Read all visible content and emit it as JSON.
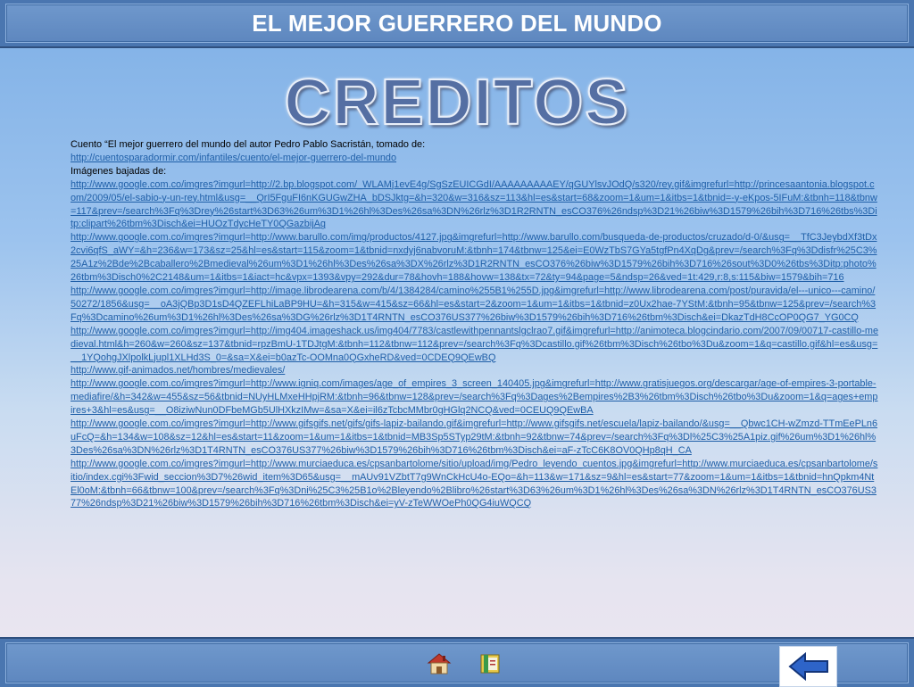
{
  "header": {
    "title": "EL MEJOR GUERRERO DEL MUNDO"
  },
  "slide": {
    "title": "CREDITOS",
    "intro": "Cuento “El mejor guerrero del mundo del autor Pedro Pablo Sacristán, tomado de:",
    "source_link": "http://cuentosparadormir.com/infantiles/cuento/el-mejor-guerrero-del-mundo",
    "images_label": "Imágenes bajadas de:",
    "image_links": [
      "http://www.google.com.co/imgres?imgurl=http://2.bp.blogspot.com/_WLAMj1evE4g/SgSzEUICGdI/AAAAAAAAAEY/qGUYlsvJOdQ/s320/rey.gif&imgrefurl=http://princesaantonia.blogspot.com/2009/05/el-sabio-y-un-rey.html&usg=__QrI5FguFI6nKGUGwZHA_bDSJktg=&h=320&w=316&sz=113&hl=es&start=68&zoom=1&um=1&itbs=1&tbnid=-y-eKpos-5IFuM:&tbnh=118&tbnw=117&prev=/search%3Fq%3Drey%26start%3D63%26um%3D1%26hl%3Des%26sa%3DN%26rlz%3D1R2RNTN_esCO376%26ndsp%3D21%26biw%3D1579%26bih%3D716%26tbs%3Ditp:clipart%26tbm%3Disch&ei=HUOzTdycHeTY0QGazbijAg",
      "http://www.google.com.co/imgres?imgurl=http://www.barullo.com/img/productos/4127.jpg&imgrefurl=http://www.barullo.com/busqueda-de-productos/cruzado/d-0/&usg=__TfC3JeybdXf3tDx2cvi6qfS_aWY=&h=236&w=173&sz=25&hl=es&start=115&zoom=1&tbnid=nxdyj6nabvoruM:&tbnh=174&tbnw=125&ei=E0WzTbS7GYa5tgfPn4XqDg&prev=/search%3Fq%3Ddisfr%25C3%25A1z%2Bde%2Bcaballero%2Bmedieval%26um%3D1%26hl%3Des%26sa%3DX%26rlz%3D1R2RNTN_esCO376%26biw%3D1579%26bih%3D716%26sout%3D0%26tbs%3Ditp:photo%26tbm%3Disch0%2C2148&um=1&itbs=1&iact=hc&vpx=1393&vpy=292&dur=78&hovh=188&hovw=138&tx=72&ty=94&page=5&ndsp=26&ved=1t:429,r:8,s:115&biw=1579&bih=716",
      "http://www.google.com.co/imgres?imgurl=http://image.librodearena.com/b/4/1384284/camino%255B1%255D.jpg&imgrefurl=http://www.librodearena.com/post/puravida/el---unico---camino/50272/1856&usg=__oA3jQBp3D1sD4QZEFLhiLaBP9HU=&h=315&w=415&sz=66&hl=es&start=2&zoom=1&um=1&itbs=1&tbnid=z0Ux2hae-7YStM:&tbnh=95&tbnw=125&prev=/search%3Fq%3Dcamino%26um%3D1%26hl%3Des%26sa%3DG%26rlz%3D1T4RNTN_esCO376US377%26biw%3D1579%26bih%3D716%26tbm%3Disch&ei=DkazTdH8CcOP0QG7_YG0CQ",
      "http://www.google.com.co/imgres?imgurl=http://img404.imageshack.us/img404/7783/castlewithpennantslgclrao7.gif&imgrefurl=http://animoteca.blogcindario.com/2007/09/00717-castillo-medieval.html&h=260&w=260&sz=137&tbnid=rpzBmU-1TDJtgM:&tbnh=112&tbnw=112&prev=/search%3Fq%3Dcastillo.gif%26tbm%3Disch%26tbo%3Du&zoom=1&q=castillo.gif&hl=es&usg=__1YQohgJXlpolkLjupl1XLHd3S_0=&sa=X&ei=b0azTc-OOMna0QGxheRD&ved=0CDEQ9QEwBQ",
      "http://www.gif-animados.net/hombres/medievales/",
      "http://www.google.com.co/imgres?imgurl=http://www.igniq.com/images/age_of_empires_3_screen_140405.jpg&imgrefurl=http://www.gratisjuegos.org/descargar/age-of-empires-3-portable-mediafire/&h=342&w=455&sz=56&tbnid=NUyHLMxeHHpjRM:&tbnh=96&tbnw=128&prev=/search%3Fq%3Dages%2Bempires%2B3%26tbm%3Disch%26tbo%3Du&zoom=1&q=ages+empires+3&hl=es&usg=__O8iziwNun0DFbeMGb5UlHXkzIMw=&sa=X&ei=il6zTcbcMMbr0gHGlq2NCQ&ved=0CEUQ9QEwBA",
      "http://www.google.com.co/imgres?imgurl=http://www.gifsgifs.net/gifs/gifs-lapiz-bailando.gif&imgrefurl=http://www.gifsgifs.net/escuela/lapiz-bailando/&usg=__Qbwc1CH-wZmzd-TTmEePLn6uFcQ=&h=134&w=108&sz=12&hl=es&start=11&zoom=1&um=1&itbs=1&tbnid=MB3Sp5STyp29tM:&tbnh=92&tbnw=74&prev=/search%3Fq%3Dl%25C3%25A1piz.gif%26um%3D1%26hl%3Des%26sa%3DN%26rlz%3D1T4RNTN_esCO376US377%26biw%3D1579%26bih%3D716%26tbm%3Disch&ei=aF-zTcC6K8OV0QHp8qH_CA",
      "http://www.google.com.co/imgres?imgurl=http://www.murciaeduca.es/cpsanbartolome/sitio/upload/img/Pedro_leyendo_cuentos.jpg&imgrefurl=http://www.murciaeduca.es/cpsanbartolome/sitio/index.cgi%3Fwid_seccion%3D7%26wid_item%3D65&usg=__mAUv91VZbtT7g9WnCkHcU4o-EQo=&h=113&w=171&sz=9&hl=es&start=77&zoom=1&um=1&itbs=1&tbnid=hnQpkm4NtEl0oM:&tbnh=66&tbnw=100&prev=/search%3Fq%3Dni%25C3%25B1o%2Bleyendo%2Blibro%26start%3D63%26um%3D1%26hl%3Des%26sa%3DN%26rlz%3D1T4RNTN_esCO376US377%26ndsp%3D21%26biw%3D1579%26bih%3D716%26tbm%3Disch&ei=yV-zTeWWOePh0QG4iuWQCQ"
    ]
  },
  "colors": {
    "header_bg": "#4a76b0",
    "link": "#1f5fa8",
    "title": "#556fa3"
  },
  "icons": {
    "home": "home-icon",
    "book": "book-icon",
    "back": "back-arrow-icon"
  }
}
